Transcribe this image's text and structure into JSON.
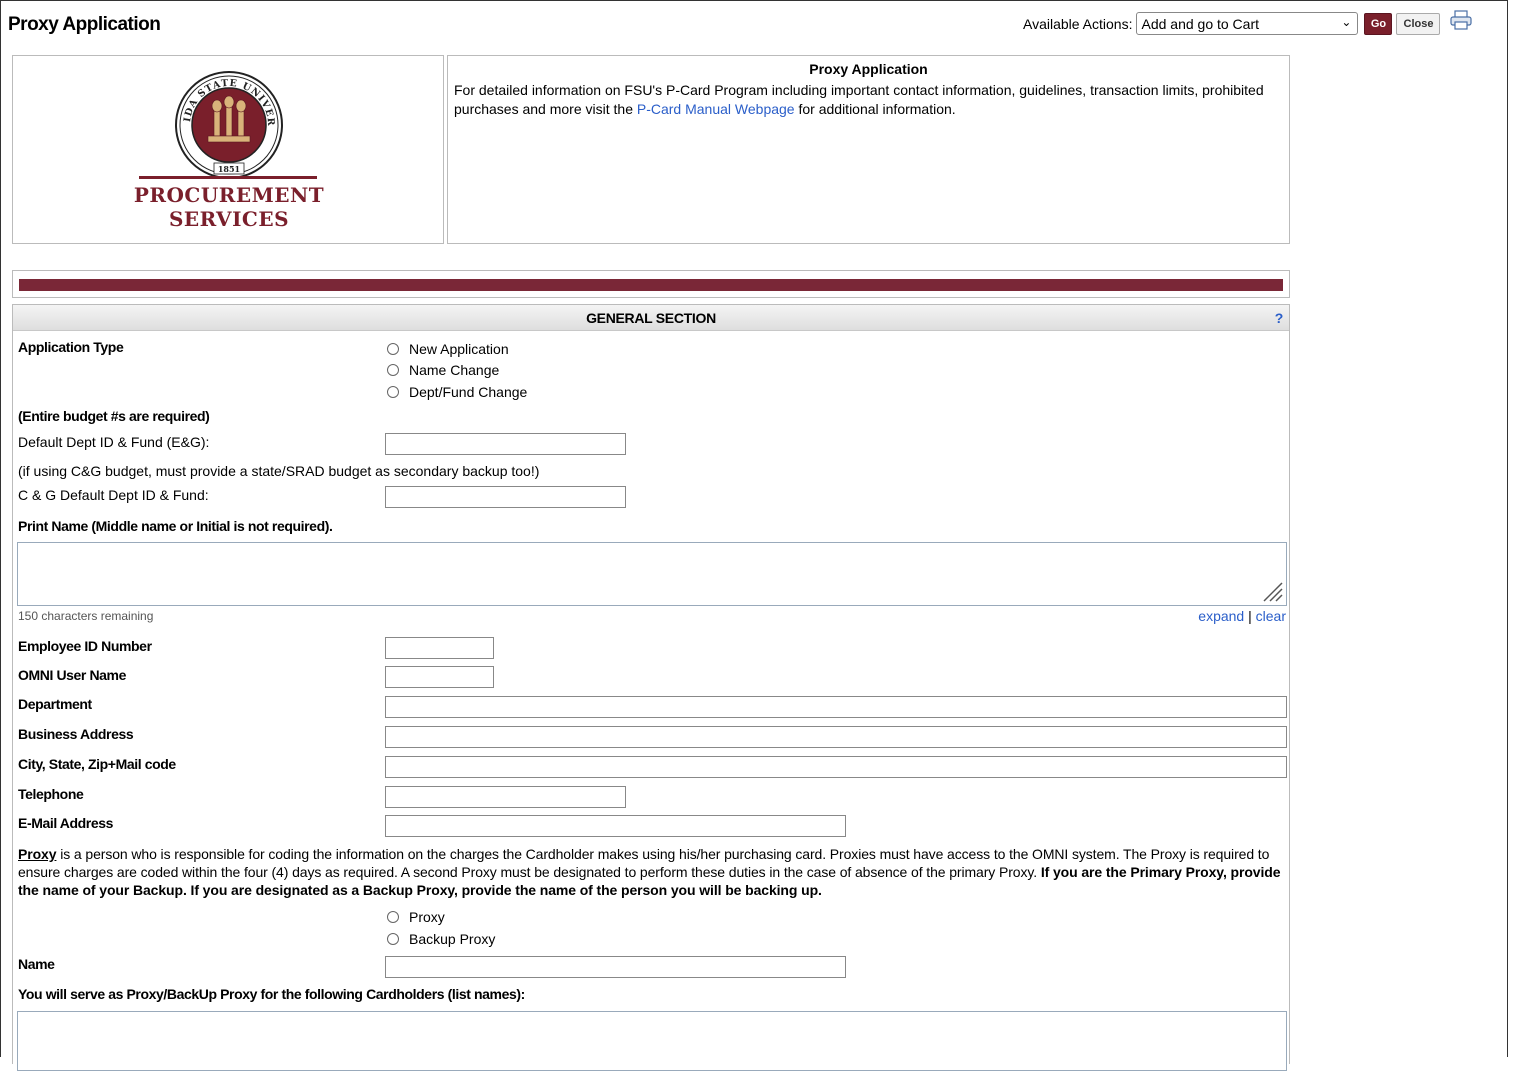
{
  "header": {
    "title": "Proxy Application",
    "actions_label": "Available Actions:",
    "actions_selected": "Add and go to Cart",
    "go_label": "Go",
    "close_label": "Close"
  },
  "logo": {
    "line1": "PROCUREMENT",
    "line2": "SERVICES",
    "seal_top": "FLORIDA STATE UNIVERSITY",
    "seal_year": "1851"
  },
  "info": {
    "title": "Proxy Application",
    "text_before": "For detailed information on FSU's P-Card Program including important contact information, guidelines, transaction limits, prohibited purchases and more visit the ",
    "link_text": "P-Card Manual Webpage",
    "text_after": " for additional information."
  },
  "section": {
    "title": "GENERAL SECTION",
    "help": "?"
  },
  "form": {
    "application_type_label": "Application Type",
    "application_type_options": [
      "New Application",
      "Name Change",
      "Dept/Fund Change"
    ],
    "budget_note": "(Entire budget #s are required)",
    "default_dept_label": "Default Dept ID & Fund (E&G):",
    "cg_note": "(if using C&G budget, must provide a state/SRAD budget as secondary backup too!)",
    "cg_dept_label": "C & G Default Dept ID & Fund:",
    "print_name_label": "Print Name (Middle name or Initial is not required).",
    "chars_remaining": "150 characters remaining",
    "expand_label": "expand",
    "separator": "|",
    "clear_label": "clear",
    "employee_id_label": "Employee ID Number",
    "omni_user_label": "OMNI User Name",
    "department_label": "Department",
    "business_address_label": "Business Address",
    "city_state_label": "City, State, Zip+Mail code",
    "telephone_label": "Telephone",
    "email_label": "E-Mail Address",
    "proxy_term": "Proxy",
    "proxy_text": " is a person who is responsible for coding the information on the charges the Cardholder makes using his/her purchasing card. Proxies must have access to the OMNI system. The Proxy is required to ensure charges are coded within the four (4) days as required. A second Proxy must be designated to perform these duties in the case of absence of the primary Proxy. ",
    "proxy_bold": "If you are the Primary Proxy, provide the name of your Backup. If you are designated as a Backup Proxy, provide the name of the person you will be backing up.",
    "proxy_options": [
      "Proxy",
      "Backup Proxy"
    ],
    "name_label": "Name",
    "cardholders_label": "You will serve as Proxy/BackUp Proxy for the following Cardholders (list names):"
  }
}
